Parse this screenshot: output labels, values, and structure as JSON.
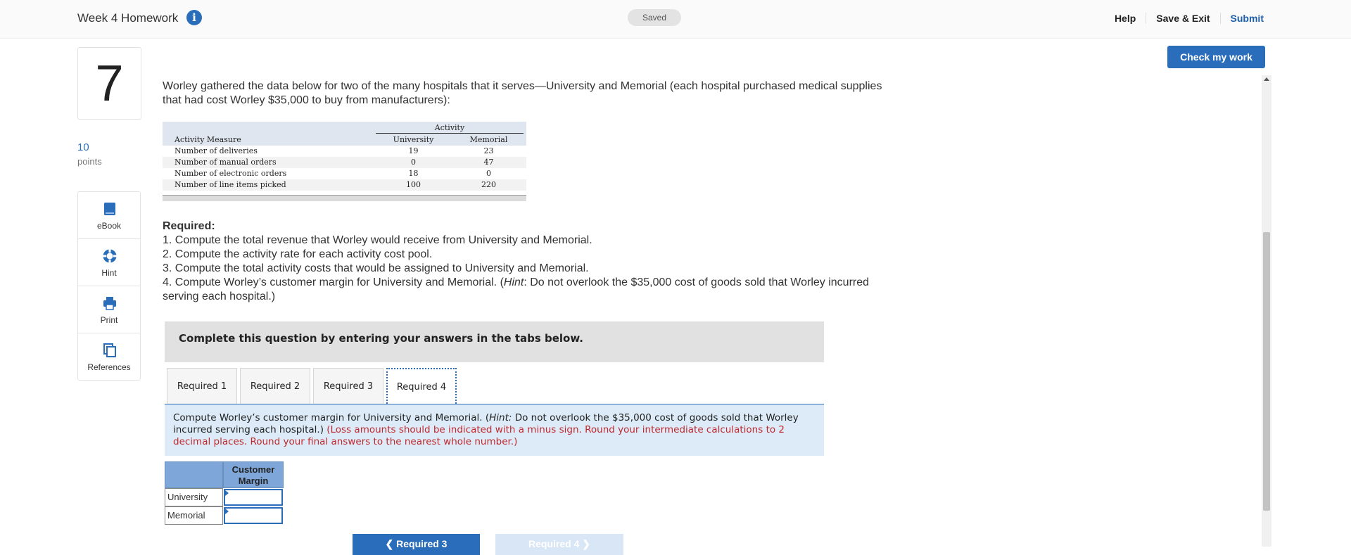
{
  "header": {
    "title": "Week 4 Homework",
    "info_icon": "info-icon",
    "status": "Saved",
    "help": "Help",
    "save_exit": "Save & Exit",
    "submit": "Submit"
  },
  "check_button": "Check my work",
  "question": {
    "number": "7",
    "points_value": "10",
    "points_label": "points"
  },
  "tools": [
    {
      "label": "eBook",
      "icon": "book-icon"
    },
    {
      "label": "Hint",
      "icon": "lifebuoy-icon"
    },
    {
      "label": "Print",
      "icon": "printer-icon"
    },
    {
      "label": "References",
      "icon": "references-icon"
    }
  ],
  "intro": "Worley gathered the data below for two of the many hospitals that it serves—University and Memorial (each hospital purchased medical supplies that had cost Worley $35,000 to buy from manufacturers):",
  "data_table": {
    "group_header": "Activity",
    "headers": [
      "Activity Measure",
      "University",
      "Memorial"
    ],
    "rows": [
      [
        "Number of deliveries",
        "19",
        "23"
      ],
      [
        "Number of manual orders",
        "0",
        "47"
      ],
      [
        "Number of electronic orders",
        "18",
        "0"
      ],
      [
        "Number of line items picked",
        "100",
        "220"
      ]
    ]
  },
  "required": {
    "heading": "Required:",
    "items": [
      "1. Compute the total revenue that Worley would receive from University and Memorial.",
      "2. Compute the activity rate for each activity cost pool.",
      "3. Compute the total activity costs that would be assigned to University and Memorial.",
      "4. Compute Worley’s customer margin for University and Memorial. ("
    ],
    "hint_word": "Hint",
    "item4_rest": ": Do not overlook the $35,000 cost of goods sold that Worley incurred serving each hospital.)"
  },
  "complete_prompt": "Complete this question by entering your answers in the tabs below.",
  "tabs": [
    "Required 1",
    "Required 2",
    "Required 3",
    "Required 4"
  ],
  "active_tab": "Required 4",
  "instructions": {
    "main_a": "Compute Worley’s customer margin for University and Memorial. (",
    "hint_word": "Hint:",
    "main_b": " Do not overlook the $35,000 cost of goods sold that Worley incurred serving each hospital.) ",
    "red": "(Loss amounts should be indicated with a minus sign.  Round your intermediate calculations to 2 decimal places.  Round your final answers to the nearest whole number.)"
  },
  "answer_table": {
    "header": "Customer Margin",
    "rows": [
      {
        "label": "University",
        "value": ""
      },
      {
        "label": "Memorial",
        "value": ""
      }
    ]
  },
  "nav_buttons": {
    "prev": "❮  Required 3",
    "next": "Required 4  ❯"
  }
}
